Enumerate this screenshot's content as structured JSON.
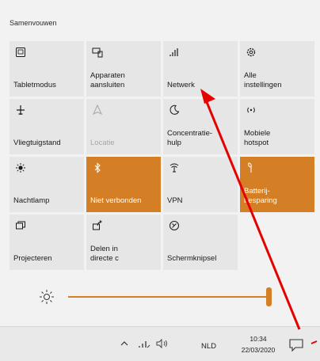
{
  "action_center": {
    "collapse_label": "Samenvouwen",
    "accent_color": "#d47f25",
    "tiles": [
      {
        "label": "Tabletmodus",
        "icon": "tablet-mode-icon",
        "state": "off"
      },
      {
        "label": "Apparaten\naansluiten",
        "icon": "connect-devices-icon",
        "state": "off"
      },
      {
        "label": "Netwerk",
        "icon": "network-icon",
        "state": "off"
      },
      {
        "label": "Alle\ninstellingen",
        "icon": "settings-gear-icon",
        "state": "off"
      },
      {
        "label": "Vliegtuigstand",
        "icon": "airplane-icon",
        "state": "off"
      },
      {
        "label": "Locatie",
        "icon": "location-icon",
        "state": "disabled"
      },
      {
        "label": "Concentratie-\nhulp",
        "icon": "moon-icon",
        "state": "off"
      },
      {
        "label": "Mobiele\nhotspot",
        "icon": "hotspot-icon",
        "state": "off"
      },
      {
        "label": "Nachtlamp",
        "icon": "night-light-icon",
        "state": "off"
      },
      {
        "label": "Niet verbonden",
        "icon": "bluetooth-icon",
        "state": "on"
      },
      {
        "label": "VPN",
        "icon": "vpn-icon",
        "state": "off"
      },
      {
        "label": "Batterij-\nbesparing",
        "icon": "battery-saver-icon",
        "state": "on"
      },
      {
        "label": "Projecteren",
        "icon": "project-icon",
        "state": "off"
      },
      {
        "label": "Delen in\ndirecte c",
        "icon": "nearby-share-icon",
        "state": "off"
      },
      {
        "label": "Schermknipsel",
        "icon": "snip-icon",
        "state": "off"
      }
    ],
    "brightness": {
      "icon": "brightness-sun-icon",
      "level": 1.0
    }
  },
  "taskbar": {
    "language": "NLD",
    "time": "10:34",
    "date": "22/03/2020",
    "icons": [
      "chevron-up-icon",
      "network-tray-icon",
      "volume-icon",
      "action-center-icon"
    ]
  }
}
